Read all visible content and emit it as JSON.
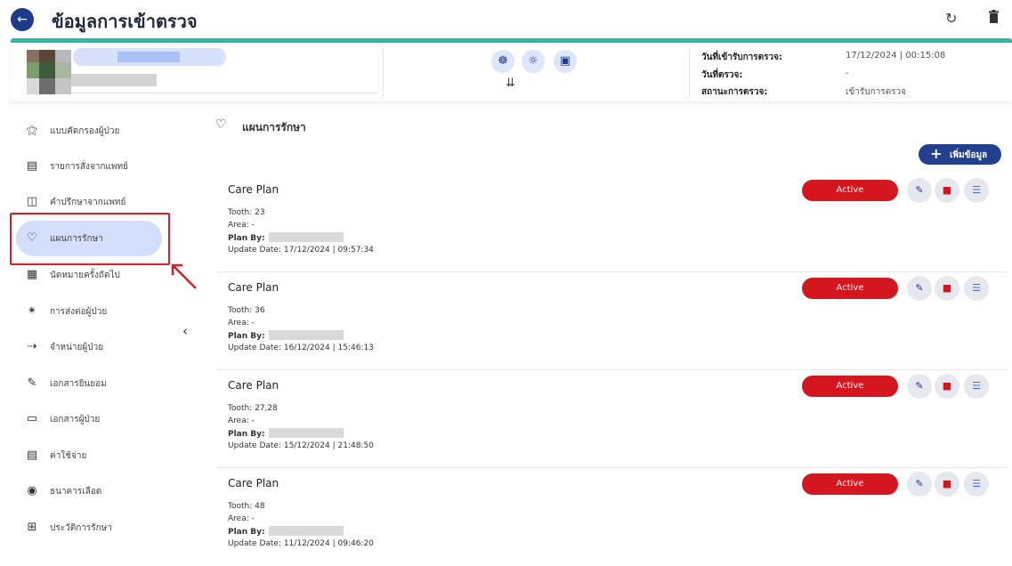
{
  "header": {
    "title": "ข้อมูลการเข้าตรวจ",
    "back_icon": "arrow-left-icon",
    "refresh_icon": "refresh-icon",
    "delete_icon": "trash-icon"
  },
  "patient": {
    "info": [
      {
        "label": "วันที่เข้ารับการตรวจ:",
        "value": "17/12/2024 | 00:15:08"
      },
      {
        "label": "วันที่ตรวจ:",
        "value": "-"
      },
      {
        "label": "สถานะการตรวจ:",
        "value": "เข้ารับการตรวจ"
      }
    ]
  },
  "sidebar": {
    "items": [
      {
        "label": "แบบคัดกรองผู้ป่วย",
        "icon": "person-search-icon"
      },
      {
        "label": "รายการสั่งจากแพทย์",
        "icon": "list-box-icon"
      },
      {
        "label": "คำปรึกษาจากแพทย์",
        "icon": "chat-icon"
      },
      {
        "label": "แผนการรักษา",
        "icon": "hand-heart-icon"
      },
      {
        "label": "นัดหมายครั้งถัดไป",
        "icon": "calendar-arrow-icon"
      },
      {
        "label": "การส่งต่อผู้ป่วย",
        "icon": "person-walk-icon"
      },
      {
        "label": "จำหน่ายผู้ป่วย",
        "icon": "logout-icon"
      },
      {
        "label": "เอกสารยินยอม",
        "icon": "signature-icon"
      },
      {
        "label": "เอกสารผู้ป่วย",
        "icon": "folder-icon"
      },
      {
        "label": "ค่าใช้จ่าย",
        "icon": "receipt-icon"
      },
      {
        "label": "ธนาคารเลือด",
        "icon": "blood-drop-icon"
      },
      {
        "label": "ประวัติการรักษา",
        "icon": "medical-bag-icon"
      }
    ],
    "active_index": 3
  },
  "main": {
    "section_title": "แผนการรักษา",
    "add_button": "เพิ่มข้อมูล",
    "plans": [
      {
        "title": "Care Plan",
        "tooth": "Tooth: 23",
        "area": "Area: -",
        "plan_by": "Plan By:",
        "update": "Update Date: 17/12/2024 | 09:57:34",
        "status": "Active"
      },
      {
        "title": "Care Plan",
        "tooth": "Tooth: 36",
        "area": "Area: -",
        "plan_by": "Plan By:",
        "update": "Update Date: 16/12/2024 | 15:46:13",
        "status": "Active"
      },
      {
        "title": "Care Plan",
        "tooth": "Tooth: 27,28",
        "area": "Area: -",
        "plan_by": "Plan By:",
        "update": "Update Date: 15/12/2024 | 21:48:50",
        "status": "Active"
      },
      {
        "title": "Care Plan",
        "tooth": "Tooth: 48",
        "area": "Area: -",
        "plan_by": "Plan By:",
        "update": "Update Date: 11/12/2024 | 09:46:20",
        "status": "Active"
      }
    ]
  },
  "colors": {
    "primary": "#1e3a8a",
    "accent_teal": "#2bb9a4",
    "status_active": "#d4161f",
    "highlight": "#e01b24"
  }
}
